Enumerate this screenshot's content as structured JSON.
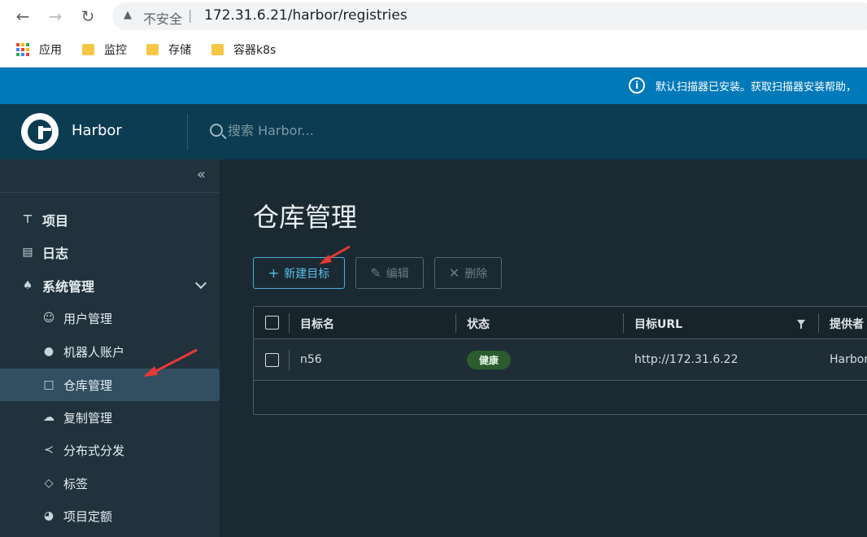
{
  "browser": {
    "url_insecure": "不安全",
    "url_separator": "|",
    "url": "172.31.6.21/harbor/registries",
    "back_icon": "arrow-left-icon",
    "forward_icon": "arrow-right-icon",
    "reload_icon": "reload-icon"
  },
  "bookmarks": [
    {
      "label": "应用",
      "icon": "apps-grid-icon"
    },
    {
      "label": "监控",
      "icon": "folder-icon"
    },
    {
      "label": "存储",
      "icon": "folder-icon"
    },
    {
      "label": "容器k8s",
      "icon": "folder-icon"
    }
  ],
  "banner": {
    "text": "默认扫描器已安装。获取扫描器安装帮助，",
    "icon": "info-circle-icon",
    "color": "#0079b8"
  },
  "header": {
    "app_name": "Harbor",
    "search_placeholder": "搜索 Harbor...",
    "color": "#0c3c52"
  },
  "sidebar": {
    "top_items": [
      {
        "label": "项目",
        "icon": "projects-icon"
      },
      {
        "label": "日志",
        "icon": "logs-icon"
      },
      {
        "label": "系统管理",
        "icon": "admin-icon",
        "expanded": true
      }
    ],
    "sub_items": [
      {
        "label": "用户管理",
        "icon": "users-icon"
      },
      {
        "label": "机器人账户",
        "icon": "robot-icon"
      },
      {
        "label": "仓库管理",
        "icon": "registry-icon",
        "active": true
      },
      {
        "label": "复制管理",
        "icon": "replication-icon"
      },
      {
        "label": "分布式分发",
        "icon": "share-icon"
      },
      {
        "label": "标签",
        "icon": "tag-icon"
      },
      {
        "label": "项目定额",
        "icon": "quota-icon"
      }
    ]
  },
  "main": {
    "title": "仓库管理",
    "buttons": {
      "new_target": "新建目标",
      "edit": "编辑",
      "delete": "删除"
    },
    "table": {
      "columns": [
        "目标名",
        "状态",
        "目标URL",
        "提供者"
      ],
      "rows": [
        {
          "name": "n56",
          "status": "健康",
          "url": "http://172.31.6.22",
          "provider": "Harbor"
        }
      ]
    }
  },
  "accent_color": "#49afd9",
  "status_healthy_color": "#2b5c2f"
}
